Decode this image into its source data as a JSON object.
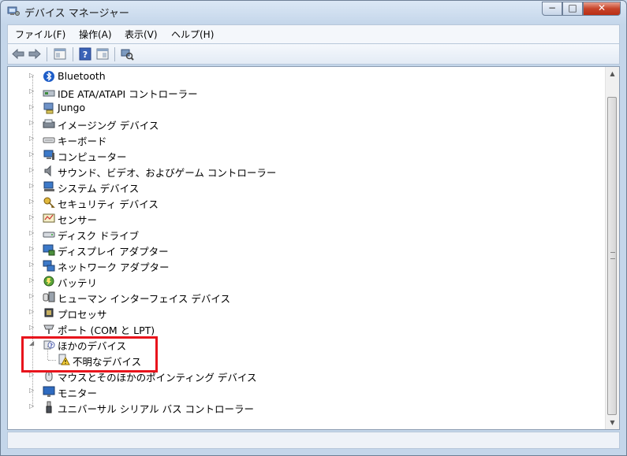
{
  "window": {
    "title": "デバイス マネージャー"
  },
  "title_controls": {
    "minimize": "−",
    "maximize": "□",
    "close": "✕"
  },
  "menu": [
    "ファイル(F)",
    "操作(A)",
    "表示(V)",
    "ヘルプ(H)"
  ],
  "toolbar_icons": [
    "back-arrow-icon",
    "forward-arrow-icon",
    "properties-view-icon",
    "help-icon",
    "panel-view-icon",
    "scan-hardware-icon"
  ],
  "tree": [
    {
      "label": "Bluetooth",
      "icon": "bluetooth-icon",
      "expanded": false,
      "level": 1
    },
    {
      "label": "IDE ATA/ATAPI コントローラー",
      "icon": "ide-controller-icon",
      "expanded": false,
      "level": 1
    },
    {
      "label": "Jungo",
      "icon": "jungo-device-icon",
      "expanded": false,
      "level": 1
    },
    {
      "label": "イメージング デバイス",
      "icon": "imaging-device-icon",
      "expanded": false,
      "level": 1
    },
    {
      "label": "キーボード",
      "icon": "keyboard-icon",
      "expanded": false,
      "level": 1
    },
    {
      "label": "コンピューター",
      "icon": "computer-icon",
      "expanded": false,
      "level": 1
    },
    {
      "label": "サウンド、ビデオ、およびゲーム コントローラー",
      "icon": "speaker-icon",
      "expanded": false,
      "level": 1
    },
    {
      "label": "システム デバイス",
      "icon": "system-device-icon",
      "expanded": false,
      "level": 1
    },
    {
      "label": "セキュリティ デバイス",
      "icon": "security-key-icon",
      "expanded": false,
      "level": 1
    },
    {
      "label": "センサー",
      "icon": "sensor-icon",
      "expanded": false,
      "level": 1
    },
    {
      "label": "ディスク ドライブ",
      "icon": "disk-drive-icon",
      "expanded": false,
      "level": 1
    },
    {
      "label": "ディスプレイ アダプター",
      "icon": "display-adapter-icon",
      "expanded": false,
      "level": 1
    },
    {
      "label": "ネットワーク アダプター",
      "icon": "network-adapter-icon",
      "expanded": false,
      "level": 1
    },
    {
      "label": "バッテリ",
      "icon": "battery-icon",
      "expanded": false,
      "level": 1
    },
    {
      "label": "ヒューマン インターフェイス デバイス",
      "icon": "hid-icon",
      "expanded": false,
      "level": 1
    },
    {
      "label": "プロセッサ",
      "icon": "processor-icon",
      "expanded": false,
      "level": 1
    },
    {
      "label": "ポート (COM と LPT)",
      "icon": "port-icon",
      "expanded": false,
      "level": 1
    },
    {
      "label": "ほかのデバイス",
      "icon": "other-devices-icon",
      "expanded": true,
      "level": 1
    },
    {
      "label": "不明なデバイス",
      "icon": "unknown-device-warning-icon",
      "expanded": null,
      "level": 2
    },
    {
      "label": "マウスとそのほかのポインティング デバイス",
      "icon": "mouse-icon",
      "expanded": false,
      "level": 1
    },
    {
      "label": "モニター",
      "icon": "monitor-icon",
      "expanded": false,
      "level": 1
    },
    {
      "label": "ユニバーサル シリアル バス コントローラー",
      "icon": "usb-icon",
      "expanded": false,
      "level": 1
    }
  ],
  "colors": {
    "highlight": "#e8141c",
    "title_bg": "#c4d6ea"
  }
}
